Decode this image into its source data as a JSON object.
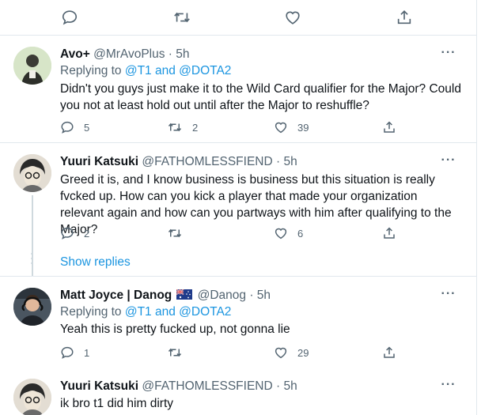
{
  "top_actions": {
    "reply": "",
    "retweet": "",
    "like": "",
    "share": ""
  },
  "tweets": [
    {
      "name": "Avo+",
      "handle": "@MrAvoPlus",
      "time": "· 5h",
      "replying_prefix": "Replying to ",
      "replying_to": "@T1 and @DOTA2",
      "text": "Didn't you guys just make it to the Wild Card qualifier for the Major? Could you not at least hold out until after the Major to reshuffle?",
      "replies": "5",
      "retweets": "2",
      "likes": "39"
    },
    {
      "name": "Yuuri Katsuki",
      "handle": "@FATHOMLESSFIEND",
      "time": "· 5h",
      "text": "Greed it is, and I know business is business but this situation is really fvcked up. How can you kick a player that made your organization relevant again and how can you partways with him after qualifying to the Major?",
      "replies": "2",
      "retweets": "",
      "likes": "6"
    },
    {
      "name": "Matt Joyce | Danog",
      "handle": "@Danog",
      "time": "· 5h",
      "replying_prefix": "Replying to ",
      "replying_to": "@T1 and @DOTA2",
      "text": "Yeah this is pretty fucked up, not gonna lie",
      "replies": "1",
      "retweets": "",
      "likes": "29"
    },
    {
      "name": "Yuuri Katsuki",
      "handle": "@FATHOMLESSFIEND",
      "time": "· 5h",
      "text": "ik bro t1 did him dirty"
    }
  ],
  "show_replies": "Show replies",
  "more_glyph": "···",
  "icons": {
    "reply": "reply-icon",
    "retweet": "retweet-icon",
    "like": "heart-icon",
    "share": "share-icon",
    "more": "more-icon",
    "flag": "australia-flag-icon"
  }
}
